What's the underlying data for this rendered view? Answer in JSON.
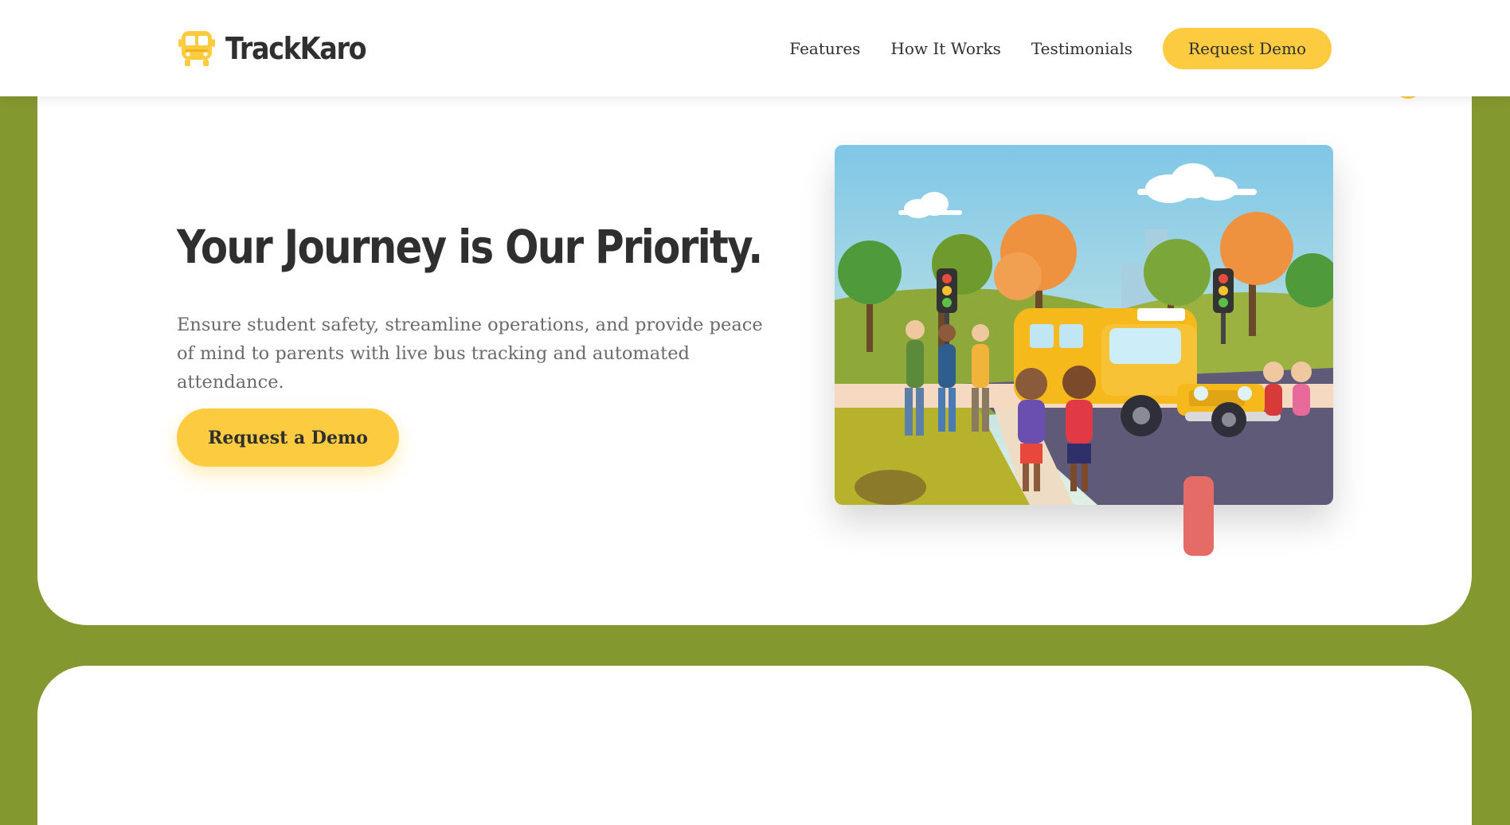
{
  "brand": {
    "name": "TrackKaro",
    "logo_icon": "bus-icon",
    "accent_color": "#fdcb3f",
    "background_color": "#849830",
    "text_color": "#2f2f2f",
    "handle_color": "#e56b67"
  },
  "nav": {
    "links": [
      {
        "label": "Features"
      },
      {
        "label": "How It Works"
      },
      {
        "label": "Testimonials"
      }
    ],
    "cta_label": "Request Demo"
  },
  "hero": {
    "title": "Your Journey is Our Priority.",
    "subtitle": "Ensure student safety, streamline operations, and provide peace of mind to parents with live bus tracking and automated attendance.",
    "cta_label": "Request a Demo",
    "illustration": "school-bus-illustration"
  }
}
